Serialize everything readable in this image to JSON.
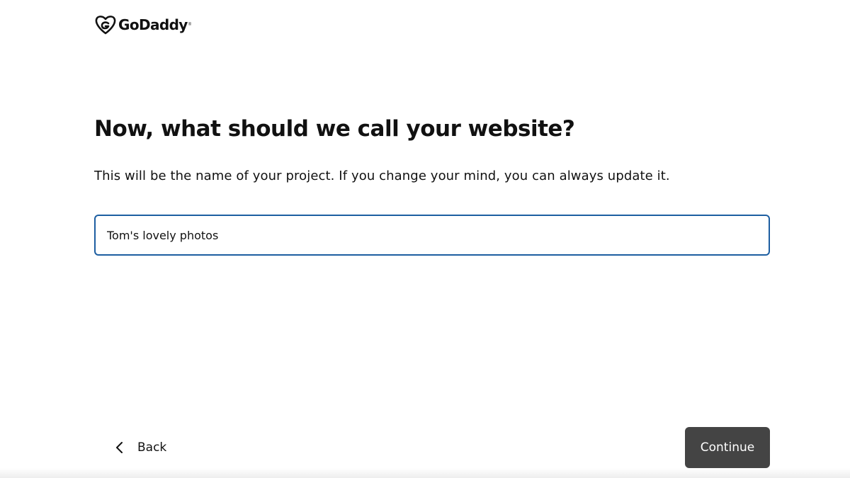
{
  "brand": {
    "name": "GoDaddy",
    "trademark": "®",
    "logo_icon": "godaddy-heart-icon"
  },
  "main": {
    "title": "Now, what should we call your website?",
    "subtitle": "This will be the name of your project. If you change your mind, you can always update it.",
    "name_input": {
      "value": "Tom's lovely photos",
      "placeholder": ""
    }
  },
  "footer": {
    "back_label": "Back",
    "back_icon": "chevron-left-icon",
    "continue_label": "Continue"
  },
  "colors": {
    "input_border": "#1d5ea1",
    "continue_bg": "#444444",
    "text": "#111111"
  }
}
